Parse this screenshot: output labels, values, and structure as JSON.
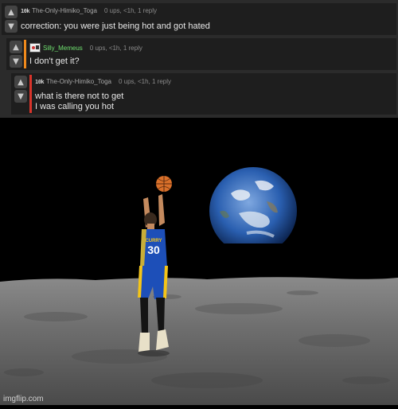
{
  "comments": [
    {
      "badge": "10k",
      "username": "The-Only-Himiko_Toga",
      "stats": "0 ups, <1h, 1 reply",
      "text": "correction: you were just being hot and got hated",
      "bar_color": ""
    },
    {
      "badge": "",
      "username": "Silly_Memeus",
      "stats": "0 ups, <1h, 1 reply",
      "text": "I don't get it?",
      "bar_color": "#f08a1c"
    },
    {
      "badge": "10k",
      "username": "The-Only-Himiko_Toga",
      "stats": "0 ups, <1h, 1 reply",
      "text_line1": "what is there not to get",
      "text_line2": "I was calling you hot",
      "bar_color": "#d9342b"
    }
  ],
  "icons": {
    "upvote": "up-arrow-icon",
    "downvote": "down-arrow-icon"
  },
  "image": {
    "jersey_name": "CURRY",
    "jersey_number": "30",
    "watermark": "imgflip.com"
  },
  "colors": {
    "comment_bg": "#1e1e1e",
    "username_green": "#6fe06f",
    "jersey_blue": "#1d4fb8",
    "jersey_gold": "#f5c518"
  }
}
